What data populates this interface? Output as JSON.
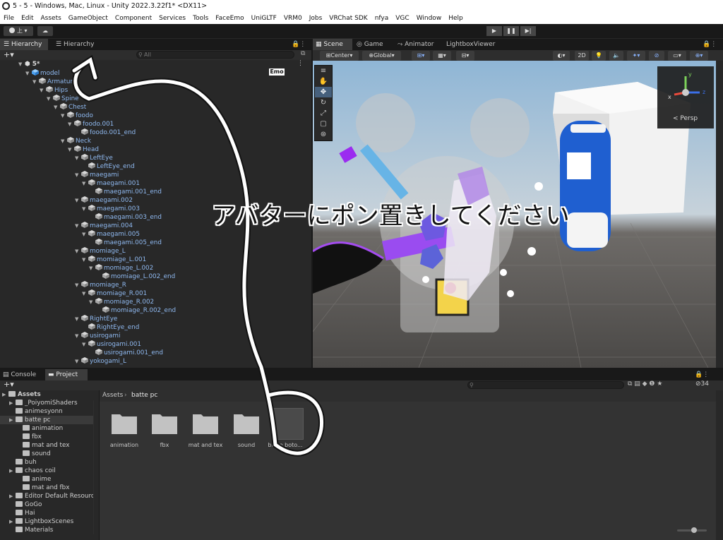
{
  "window": {
    "title": "5 - 5 - Windows, Mac, Linux - Unity 2022.3.22f1* <DX11>"
  },
  "menu": [
    "File",
    "Edit",
    "Assets",
    "GameObject",
    "Component",
    "Services",
    "Tools",
    "FaceEmo",
    "UniGLTF",
    "VRM0",
    "Jobs",
    "VRChat SDK",
    "nfya",
    "VGC",
    "Window",
    "Help"
  ],
  "toolbar": {
    "account_label": "上",
    "play_icon": "play-icon",
    "pause_icon": "pause-icon",
    "step_icon": "step-icon"
  },
  "hierarchy": {
    "tabs": [
      "Hierarchy",
      "Hierarchy"
    ],
    "search_placeholder": "All",
    "scene_name": "5*",
    "emo_badge": "Emo",
    "rows": [
      {
        "label": "model",
        "depth": 1
      },
      {
        "label": "Armature",
        "depth": 2
      },
      {
        "label": "Hips",
        "depth": 3
      },
      {
        "label": "Spine",
        "depth": 4
      },
      {
        "label": "Chest",
        "depth": 5
      },
      {
        "label": "foodo",
        "depth": 6
      },
      {
        "label": "foodo.001",
        "depth": 7
      },
      {
        "label": "foodo.001_end",
        "depth": 8
      },
      {
        "label": "Neck",
        "depth": 6
      },
      {
        "label": "Head",
        "depth": 7
      },
      {
        "label": "LeftEye",
        "depth": 8
      },
      {
        "label": "LeftEye_end",
        "depth": 9
      },
      {
        "label": "maegami",
        "depth": 8
      },
      {
        "label": "maegami.001",
        "depth": 9
      },
      {
        "label": "maegami.001_end",
        "depth": 10
      },
      {
        "label": "maegami.002",
        "depth": 8
      },
      {
        "label": "maegami.003",
        "depth": 9
      },
      {
        "label": "maegami.003_end",
        "depth": 10
      },
      {
        "label": "maegami.004",
        "depth": 8
      },
      {
        "label": "maegami.005",
        "depth": 9
      },
      {
        "label": "maegami.005_end",
        "depth": 10
      },
      {
        "label": "momiage_L",
        "depth": 8
      },
      {
        "label": "momiage_L.001",
        "depth": 9
      },
      {
        "label": "momiage_L.002",
        "depth": 10
      },
      {
        "label": "momiage_L.002_end",
        "depth": 11
      },
      {
        "label": "momiage_R",
        "depth": 8
      },
      {
        "label": "momiage_R.001",
        "depth": 9
      },
      {
        "label": "momiage_R.002",
        "depth": 10
      },
      {
        "label": "momiage_R.002_end",
        "depth": 11
      },
      {
        "label": "RightEye",
        "depth": 8
      },
      {
        "label": "RightEye_end",
        "depth": 9
      },
      {
        "label": "usirogami",
        "depth": 8
      },
      {
        "label": "usirogami.001",
        "depth": 9
      },
      {
        "label": "usirogami.001_end",
        "depth": 10
      },
      {
        "label": "yokogami_L",
        "depth": 8
      }
    ]
  },
  "scene": {
    "tabs": [
      "Scene",
      "Game",
      "Animator",
      "LightboxViewer"
    ],
    "pivot": "Center",
    "space": "Global",
    "mode_2d": "2D",
    "gizmo": {
      "x": "x",
      "y": "y",
      "z": "z",
      "projection": "< Persp"
    },
    "overlay_text": "アバターにポン置きしてください"
  },
  "project": {
    "tabs": [
      "Console",
      "Project"
    ],
    "item_count": "34",
    "tree": [
      {
        "label": "Assets",
        "depth": 0,
        "bold": true
      },
      {
        "label": "_PoiyomiShaders",
        "depth": 1
      },
      {
        "label": "animesyonn",
        "depth": 1
      },
      {
        "label": "batte pc",
        "depth": 1,
        "selected": true
      },
      {
        "label": "animation",
        "depth": 2
      },
      {
        "label": "fbx",
        "depth": 2
      },
      {
        "label": "mat and tex",
        "depth": 2
      },
      {
        "label": "sound",
        "depth": 2
      },
      {
        "label": "buh",
        "depth": 1
      },
      {
        "label": "chaos coil",
        "depth": 1
      },
      {
        "label": "anime",
        "depth": 2
      },
      {
        "label": "mat and fbx",
        "depth": 2
      },
      {
        "label": "Editor Default Resourc",
        "depth": 1
      },
      {
        "label": "GoGo",
        "depth": 1
      },
      {
        "label": "Hai",
        "depth": 1
      },
      {
        "label": "LightboxScenes",
        "depth": 1
      },
      {
        "label": "Materials",
        "depth": 1
      }
    ],
    "breadcrumb": [
      "Assets",
      "batte pc"
    ],
    "items": [
      "animation",
      "fbx",
      "mat and tex",
      "sound",
      "batte boto..."
    ]
  }
}
